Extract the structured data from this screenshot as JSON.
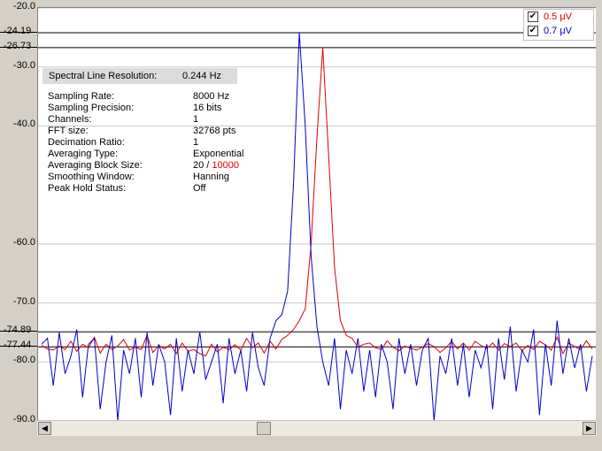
{
  "chart_data": {
    "type": "line",
    "ylim": [
      -90,
      -20
    ],
    "y_ticks": [
      "-20.0",
      "-30.0",
      "-40.0",
      "-60.0",
      "-70.0",
      "-80.0",
      "-90.0"
    ],
    "y_tick_values": [
      -20,
      -30,
      -40,
      -60,
      -70,
      -80,
      -90
    ],
    "grid": true,
    "markers": [
      {
        "label": "-24.19",
        "value": -24.19
      },
      {
        "label": "-26.73",
        "value": -26.73
      },
      {
        "label": "-74.89",
        "value": -74.89
      },
      {
        "label": "-77.44",
        "value": -77.44
      }
    ],
    "legend_position": "top-right",
    "series": [
      {
        "name": "0.5 μV",
        "color": "#e00000",
        "peak_index": 48,
        "peak_value": -26.73,
        "values": [
          -77.2,
          -77.8,
          -78.0,
          -77.3,
          -77.9,
          -76.5,
          -78.2,
          -77.0,
          -77.6,
          -75.8,
          -78.5,
          -77.0,
          -77.9,
          -77.3,
          -76.2,
          -78.0,
          -77.5,
          -77.9,
          -75.5,
          -78.4,
          -77.2,
          -77.8,
          -77.0,
          -78.6,
          -76.8,
          -78.2,
          -77.9,
          -78.6,
          -79.0,
          -77.0,
          -78.3,
          -77.5,
          -77.9,
          -77.1,
          -78.0,
          -76.0,
          -77.6,
          -76.8,
          -78.5,
          -76.5,
          -77.8,
          -76.2,
          -75.5,
          -74.5,
          -73.0,
          -71.0,
          -60.0,
          -42.0,
          -26.73,
          -45.0,
          -64.0,
          -73.0,
          -75.5,
          -76.0,
          -77.5,
          -77.0,
          -76.8,
          -77.6,
          -77.9,
          -76.4,
          -77.5,
          -78.1,
          -77.3,
          -77.7,
          -78.0,
          -77.5,
          -76.9,
          -77.4,
          -78.4,
          -77.6,
          -76.5,
          -77.8,
          -76.8,
          -78.0,
          -76.5,
          -77.2,
          -77.7,
          -76.8,
          -78.0,
          -76.9,
          -77.4,
          -76.8,
          -78.1,
          -77.2,
          -77.9,
          -76.5,
          -77.1,
          -78.0,
          -75.8,
          -78.6,
          -76.8,
          -77.4,
          -77.9,
          -76.4,
          -77.8
        ]
      },
      {
        "name": "0.7 μV",
        "color": "#0000c8",
        "peak_index": 44,
        "peak_value": -24.19,
        "values": [
          -77.0,
          -76.0,
          -84.0,
          -75.0,
          -82.0,
          -79.0,
          -74.5,
          -86.0,
          -77.0,
          -76.0,
          -88.0,
          -80.0,
          -75.5,
          -90.0,
          -78.0,
          -82.0,
          -76.0,
          -86.0,
          -75.0,
          -84.0,
          -77.0,
          -80.0,
          -89.0,
          -76.0,
          -85.0,
          -78.0,
          -82.0,
          -74.9,
          -83.0,
          -80.0,
          -77.0,
          -87.0,
          -76.0,
          -82.0,
          -78.0,
          -85.0,
          -75.0,
          -81.0,
          -84.0,
          -76.0,
          -73.0,
          -72.0,
          -68.0,
          -50.0,
          -24.19,
          -40.0,
          -62.0,
          -74.0,
          -80.0,
          -84.0,
          -76.0,
          -88.0,
          -78.0,
          -82.0,
          -76.0,
          -85.0,
          -78.0,
          -86.0,
          -77.0,
          -80.0,
          -88.0,
          -76.0,
          -82.0,
          -77.0,
          -84.0,
          -78.0,
          -76.0,
          -90.0,
          -79.0,
          -82.0,
          -76.0,
          -84.0,
          -77.0,
          -86.0,
          -78.0,
          -81.0,
          -77.0,
          -88.0,
          -76.0,
          -83.0,
          -74.0,
          -85.0,
          -78.0,
          -80.0,
          -74.5,
          -89.0,
          -77.0,
          -84.0,
          -73.0,
          -82.0,
          -76.0,
          -81.0,
          -77.0,
          -85.0,
          -79.0
        ]
      }
    ]
  },
  "legend": {
    "items": [
      {
        "label": "0.5 μV",
        "checked": "✔",
        "color": "#e00000"
      },
      {
        "label": "0.7 μV",
        "checked": "✔",
        "color": "#0000c8"
      }
    ]
  },
  "info": {
    "resolution_label": "Spectral Line Resolution:",
    "resolution_value": "0.244 Hz",
    "rows": [
      {
        "label": "Sampling Rate:",
        "value": "8000 Hz"
      },
      {
        "label": "Sampling Precision:",
        "value": "16 bits"
      },
      {
        "label": "Channels:",
        "value": "1"
      },
      {
        "label": "FFT size:",
        "value": "32768 pts"
      },
      {
        "label": "Decimation Ratio:",
        "value": "1"
      },
      {
        "label": "Averaging Type:",
        "value": "Exponential"
      },
      {
        "label": "Averaging Block Size:",
        "value": "20 / ",
        "value_red": "10000"
      },
      {
        "label": "Smoothing Window:",
        "value": "Hanning"
      },
      {
        "label": "Peak Hold Status:",
        "value": "Off"
      }
    ]
  },
  "scrollbar": {
    "left_arrow": "◀",
    "right_arrow": "▶"
  }
}
